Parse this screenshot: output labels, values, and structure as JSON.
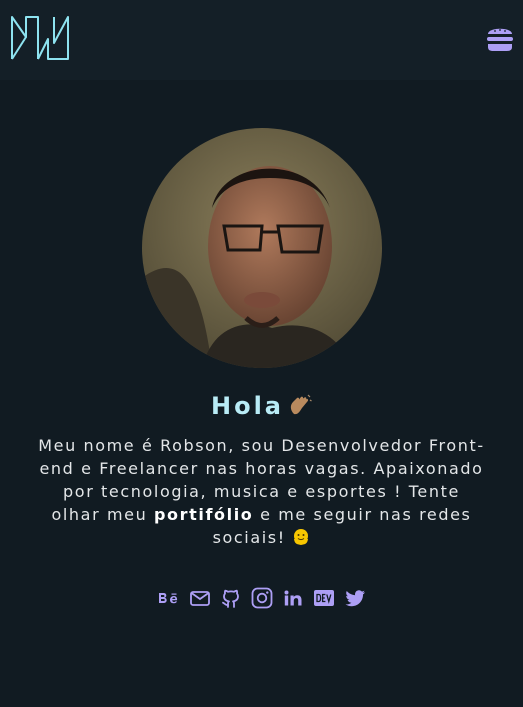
{
  "colors": {
    "background": "#111b22",
    "header": "#141f27",
    "accent": "#ad9ff5",
    "greeting": "#b9ecf6",
    "logo": "#8ee3f0"
  },
  "header": {
    "logo_icon": "rn-monogram-logo",
    "menu_icon": "hamburger-icon"
  },
  "profile": {
    "photo": "profile-photo"
  },
  "greeting": {
    "text": "Hola",
    "emoji_icon": "waving-hand-icon"
  },
  "bio": {
    "text_before": "Meu nome é Robson, sou Desenvolvedor Front-end e Freelancer nas horas vagas. Apaixonado por tecnologia, musica e esportes ! Tente olhar meu ",
    "link_text": "portifólio",
    "text_after": " e me seguir nas redes sociais! ",
    "emoji_icon": "melting-face-icon"
  },
  "socials": [
    {
      "name": "Behance",
      "icon": "behance-icon"
    },
    {
      "name": "Email",
      "icon": "mail-icon"
    },
    {
      "name": "GitHub",
      "icon": "github-icon"
    },
    {
      "name": "Instagram",
      "icon": "instagram-icon"
    },
    {
      "name": "LinkedIn",
      "icon": "linkedin-icon"
    },
    {
      "name": "DEV",
      "icon": "dev-icon"
    },
    {
      "name": "Twitter",
      "icon": "twitter-icon"
    }
  ]
}
